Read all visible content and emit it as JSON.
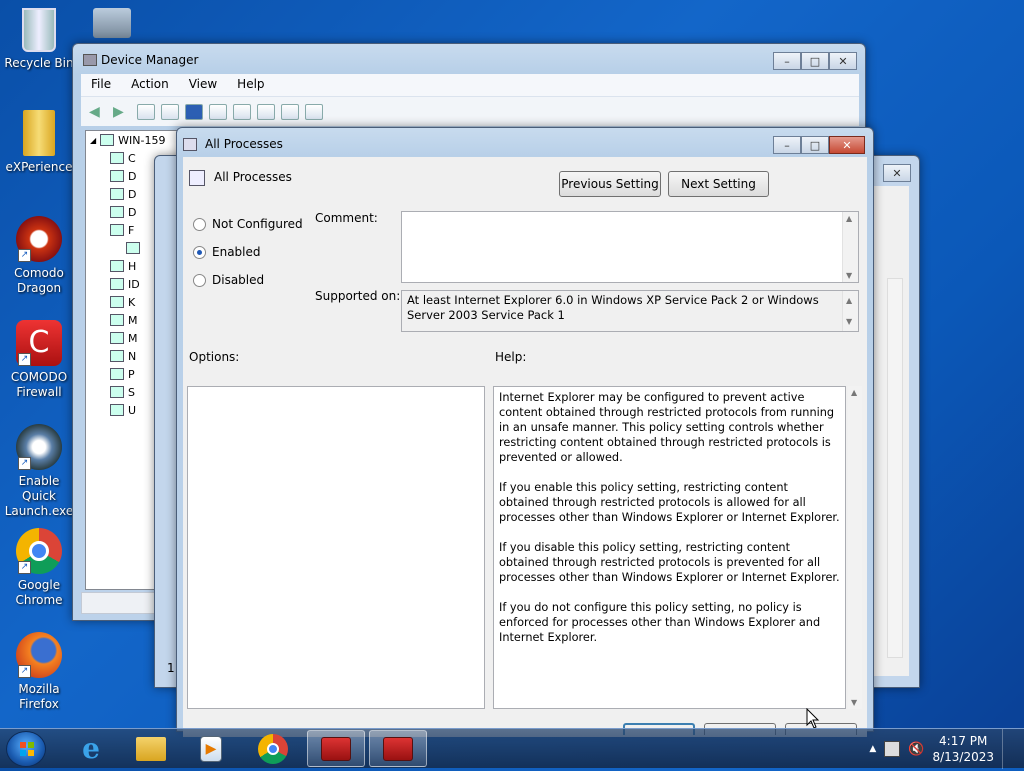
{
  "desktop": {
    "icons": [
      {
        "label": "Recycle Bin"
      },
      {
        "label": "eXPerience"
      },
      {
        "label": "Comodo Dragon"
      },
      {
        "label": "COMODO Firewall"
      },
      {
        "label": "Enable Quick Launch.exe"
      },
      {
        "label": "Google Chrome"
      },
      {
        "label": "Mozilla Firefox"
      }
    ]
  },
  "device_manager": {
    "title": "Device Manager",
    "menu": [
      "File",
      "Action",
      "View",
      "Help"
    ],
    "tree_root": "WIN-159",
    "tree_items": [
      "C",
      "D",
      "D",
      "D",
      "F",
      "",
      "H",
      "ID",
      "K",
      "M",
      "M",
      "N",
      "P",
      "S",
      "U"
    ]
  },
  "background_dialog": {
    "fragment_1": "1"
  },
  "dialog": {
    "title": "All Processes",
    "heading": "All Processes",
    "prev_button": "Previous Setting",
    "next_button": "Next Setting",
    "radios": {
      "not_configured": "Not Configured",
      "enabled": "Enabled",
      "disabled": "Disabled",
      "selected": "Enabled"
    },
    "comment_label": "Comment:",
    "comment_value": "",
    "supported_label": "Supported on:",
    "supported_value": "At least Internet Explorer 6.0 in Windows XP Service Pack 2 or Windows Server 2003 Service Pack 1",
    "options_label": "Options:",
    "help_label": "Help:",
    "help_paragraphs": [
      "Internet Explorer may be configured to prevent active content obtained through restricted protocols from running in an unsafe manner. This policy setting controls whether restricting content obtained through restricted protocols is prevented or allowed.",
      "If you enable this policy setting, restricting content obtained through restricted protocols is allowed for all processes other than Windows Explorer or Internet Explorer.",
      "If you disable this policy setting, restricting content obtained through restricted protocols is prevented for all processes other than Windows Explorer or Internet Explorer.",
      "If you do not configure this policy setting, no policy is enforced for processes other than Windows Explorer and Internet Explorer."
    ]
  },
  "taskbar": {
    "time": "4:17 PM",
    "date": "8/13/2023"
  },
  "colors": {
    "desktop": "#1366c9",
    "accent": "#1e58b6"
  }
}
